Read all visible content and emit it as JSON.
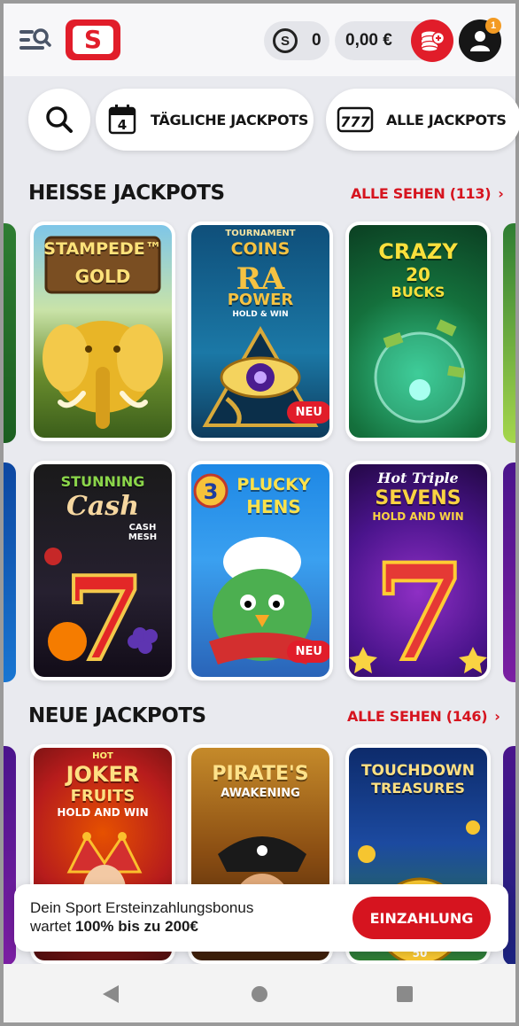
{
  "header": {
    "coins": "0",
    "coin_symbol": "S",
    "balance": "0,00 €",
    "notification_count": "1",
    "logo_letter": "S",
    "brand_color": "#e11d2a"
  },
  "quicknav": {
    "daily_jackpots": "TÄGLICHE JACKPOTS",
    "daily_icon_text": "4",
    "all_jackpots": "ALLE JACKPOTS",
    "all_icon_text": "777"
  },
  "hot": {
    "title": "HEISSE JACKPOTS",
    "see_all": "ALLE SEHEN (113)",
    "games": [
      {
        "title": "STAMPEDE",
        "sub": "GOLD",
        "tm": "™"
      },
      {
        "title": "COINS",
        "sub": "POWER",
        "extra": "TOURNAMENT",
        "sub2": "HOLD & WIN",
        "rune": "RA",
        "badge": "NEU"
      },
      {
        "title": "CRAZY",
        "sub": "20",
        "sub2": "BUCKS"
      },
      {
        "title": "STUNNING",
        "sub": "Cash",
        "extra": "CASH MESH",
        "seven": "7"
      },
      {
        "title": "PLUCKY",
        "sub": "HENS",
        "num": "3",
        "badge": "NEU"
      },
      {
        "title": "Hot Triple",
        "sub": "SEVENS",
        "sub2": "HOLD AND WIN",
        "seven": "7"
      }
    ]
  },
  "new": {
    "title": "NEUE JACKPOTS",
    "see_all": "ALLE SEHEN (146)",
    "games": [
      {
        "title": "JOKER",
        "sub": "FRUITS",
        "extra": "HOT",
        "sub2": "HOLD AND WIN"
      },
      {
        "title": "PIRATE'S",
        "sub": "AWAKENING"
      },
      {
        "title": "TOUCHDOWN",
        "sub": "TREASURES",
        "yard": "50"
      }
    ]
  },
  "banner": {
    "line1": "Dein Sport Ersteinzahlungsbonus",
    "line2_prefix": "wartet ",
    "line2_bold": "100% bis zu 200€",
    "button": "EINZAHLUNG"
  }
}
